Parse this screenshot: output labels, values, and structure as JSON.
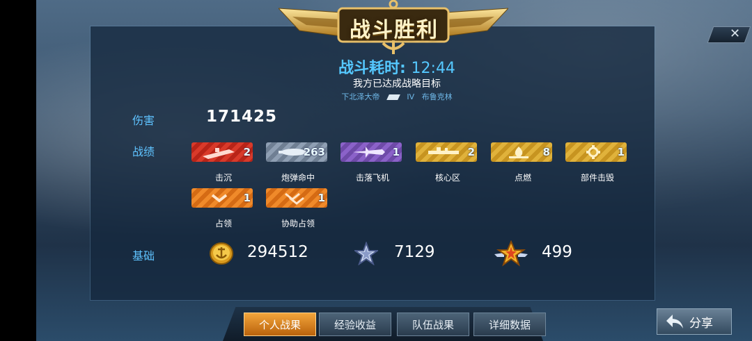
{
  "title": "战斗胜利",
  "battle_time": {
    "label": "战斗耗时:",
    "value": "12:44"
  },
  "objective": "我方已达成战略目标",
  "matchup": {
    "ship_a": "下北泽大帝",
    "tier": "IV",
    "ship_b": "布鲁克林"
  },
  "damage": {
    "label": "伤害",
    "value": "171425"
  },
  "achievements": {
    "label": "战绩",
    "items": [
      {
        "name": "击沉",
        "count": "2",
        "color": "red",
        "icon": "ship-sinking-icon"
      },
      {
        "name": "炮弹命中",
        "count": "263",
        "color": "steel",
        "icon": "shell-icon"
      },
      {
        "name": "击落飞机",
        "count": "1",
        "color": "violet",
        "icon": "plane-icon"
      },
      {
        "name": "核心区",
        "count": "2",
        "color": "gold",
        "icon": "citadel-icon"
      },
      {
        "name": "点燃",
        "count": "8",
        "color": "gold",
        "icon": "fire-icon"
      },
      {
        "name": "部件击毁",
        "count": "1",
        "color": "gold",
        "icon": "gear-icon"
      },
      {
        "name": "占领",
        "count": "1",
        "color": "orange",
        "icon": "chevron-icon"
      },
      {
        "name": "协助占领",
        "count": "1",
        "color": "orange",
        "icon": "double-chevron-icon"
      }
    ]
  },
  "base": {
    "label": "基础",
    "coins": {
      "icon": "anchor-coin-icon",
      "value": "294512"
    },
    "free_exp": {
      "icon": "silver-star-icon",
      "value": "7129"
    },
    "exp": {
      "icon": "gold-star-icon",
      "value": "499"
    }
  },
  "tabs": [
    "个人战果",
    "经验收益",
    "队伍战果",
    "详细数据"
  ],
  "active_tab": 0,
  "share_label": "分享",
  "colors": {
    "accent_blue": "#5fc3ff",
    "active_tab": "#f08a2a"
  }
}
